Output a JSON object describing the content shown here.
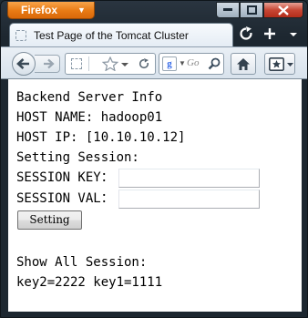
{
  "browser": {
    "app_button_label": "Firefox",
    "tab_title": "Test Page of the Tomcat Cluster",
    "search_placeholder": "Go",
    "search_engine_letter": "g"
  },
  "page": {
    "lines": [
      "Backend Server Info",
      "HOST NAME: hadoop01",
      "HOST IP: [10.10.10.12]",
      "Setting Session:"
    ],
    "session_key_label": "SESSION KEY：",
    "session_key_value": "",
    "session_val_label": "SESSION VAL：",
    "session_val_value": "",
    "setting_button_label": "Setting",
    "show_all_heading": "Show All Session:",
    "sessions_text": "key2=2222 key1=1111"
  },
  "colors": {
    "firefox_orange": "#e87a14",
    "frame_dark": "#1d2730",
    "close_red": "#c74634"
  }
}
